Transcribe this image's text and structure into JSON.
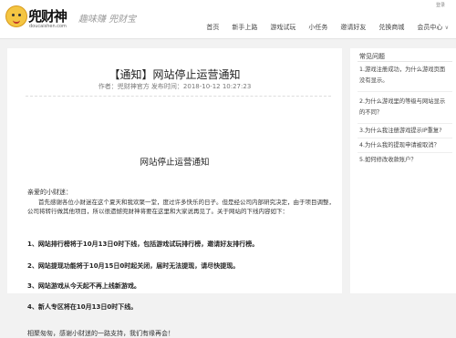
{
  "header": {
    "login": "登录",
    "logo_name": "兜财神",
    "logo_domain": "doucaishen.com",
    "logo_slogan": "趣味赚 兜财宝",
    "nav": [
      {
        "label": "首页"
      },
      {
        "label": "新手上路"
      },
      {
        "label": "游戏试玩"
      },
      {
        "label": "小任务"
      },
      {
        "label": "邀请好友"
      },
      {
        "label": "兑换商城"
      },
      {
        "label": "会员中心"
      }
    ],
    "dropdown_glyph": "∨"
  },
  "article": {
    "title": "【通知】网站停止运营通知",
    "meta": "作者：兜财神官方   发布时间：2018-10-12 10:27:23",
    "notice_heading": "网站停止运营通知",
    "greeting": "亲爱的小财迷：",
    "body": "首先感谢各位小财迷在这个夏天和我欢聚一堂，度过许多快乐的日子。但是经公司内部研究决定，由于项目调整，公司将转行做其他项目，所以很遗憾兜财神将要在这里和大家说再见了。关于网站的下线内容如下：",
    "points": [
      "1、网站排行榜将于10月13日0时下线，包括游戏试玩排行榜，邀请好友排行榜。",
      "2、网站提现功能将于10月15日0时起关闭，届时无法提现，请尽快提现。",
      "3、网站游戏从今天起不再上线新游戏。",
      "4、新人专区将在10月13日0时下线。"
    ],
    "closing": "相聚匆匆，感谢小财迷的一路支持，我们有缘再会！"
  },
  "sidebar": {
    "title": "常见问题",
    "faqs": [
      "1.游戏注册成功，为什么游戏页面没有显示。",
      "2.为什么游戏里的等级与网站显示的不同？",
      "3.为什么我注册游戏提示IP重复?",
      "4.为什么我的提现申请被取消？",
      "5.如何修改收款账户？"
    ]
  },
  "colors": {
    "page_bg": "#f2f2f2",
    "card_bg": "#ffffff",
    "logo_yellow": "#f4c542"
  }
}
